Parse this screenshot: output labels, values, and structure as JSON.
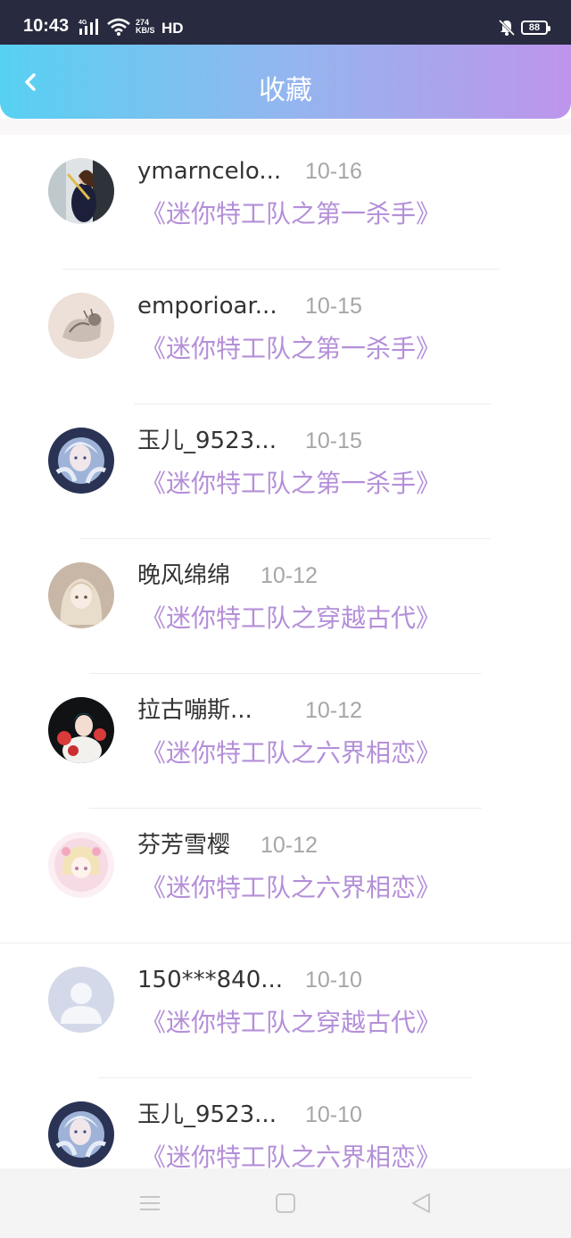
{
  "status_bar": {
    "time": "10:43",
    "network_speed": "274\nKB/S",
    "hd": "HD",
    "battery": "88"
  },
  "header": {
    "title": "收藏",
    "back_icon": "chevron-left-icon"
  },
  "items": [
    {
      "name": "ymarncelo...",
      "date": "10-16",
      "book": "《迷你特工队之第一杀手》"
    },
    {
      "name": "emporioar...",
      "date": "10-15",
      "book": "《迷你特工队之第一杀手》"
    },
    {
      "name": "玉儿_9523...",
      "date": "10-15",
      "book": "《迷你特工队之第一杀手》"
    },
    {
      "name": "晚风绵绵",
      "date": "10-12",
      "book": "《迷你特工队之穿越古代》"
    },
    {
      "name": "拉古嘣斯...",
      "date": "10-12",
      "book": "《迷你特工队之六界相恋》"
    },
    {
      "name": "芬芳雪樱",
      "date": "10-12",
      "book": "《迷你特工队之六界相恋》"
    },
    {
      "name": "150***840...",
      "date": "10-10",
      "book": "《迷你特工队之穿越古代》"
    },
    {
      "name": "玉儿_9523...",
      "date": "10-10",
      "book": "《迷你特工队之六界相恋》"
    }
  ],
  "nav_bar": {
    "icons": [
      "menu-icon",
      "home-square-icon",
      "back-triangle-icon"
    ]
  }
}
